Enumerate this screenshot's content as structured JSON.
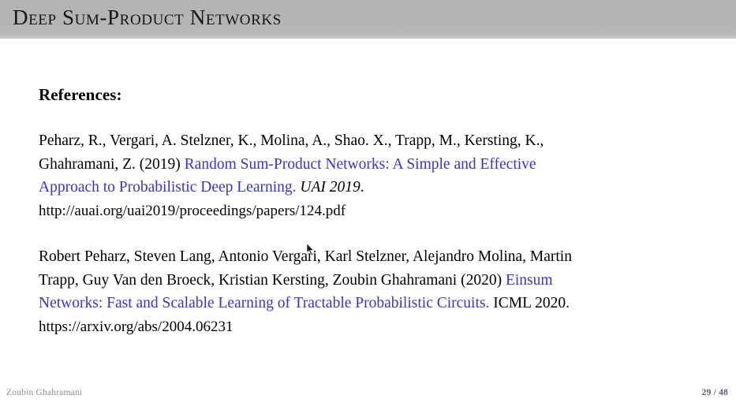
{
  "slide": {
    "title": "Deep Sum-Product Networks",
    "header_color": "#b3b3b3",
    "link_color": "#3a33cc"
  },
  "content": {
    "references_heading": "References:",
    "references": [
      {
        "id": "ref-rat-spn",
        "lines": [
          [
            {
              "text": "Peharz, R., Vergari, A. Stelzner, K., Molina, A., Shao. X., Trapp, M., Kersting, K.,",
              "style": "plain"
            }
          ],
          [
            {
              "text": "Ghahramani, Z. (2019) ",
              "style": "plain"
            },
            {
              "text": "Random Sum-Product Networks: A Simple and Effective",
              "style": "link"
            }
          ],
          [
            {
              "text": "Approach to Probabilistic Deep Learning.",
              "style": "link"
            },
            {
              "text": " ",
              "style": "plain"
            },
            {
              "text": "UAI 2019",
              "style": "italic"
            },
            {
              "text": ".",
              "style": "plain"
            }
          ],
          [
            {
              "text": "http://auai.org/uai2019/proceedings/papers/124.pdf",
              "style": "url"
            }
          ]
        ]
      },
      {
        "id": "ref-einsum-networks",
        "lines": [
          [
            {
              "text": "Robert Peharz, Steven Lang, Antonio Vergari, Karl Stelzner, Alejandro Molina, Martin",
              "style": "plain"
            }
          ],
          [
            {
              "text": "Trapp, Guy Van den Broeck, Kristian Kersting, Zoubin Ghahramani (2020) ",
              "style": "plain"
            },
            {
              "text": "Einsum",
              "style": "link"
            }
          ],
          [
            {
              "text": "Networks: Fast and Scalable Learning of Tractable Probabilistic Circuits.",
              "style": "link"
            },
            {
              "text": " ICML 2020.",
              "style": "plain"
            }
          ],
          [
            {
              "text": "https://arxiv.org/abs/2004.06231",
              "style": "url"
            }
          ]
        ]
      }
    ]
  },
  "footer": {
    "author": "Zoubin Ghahramani",
    "page": "29 / 48"
  }
}
